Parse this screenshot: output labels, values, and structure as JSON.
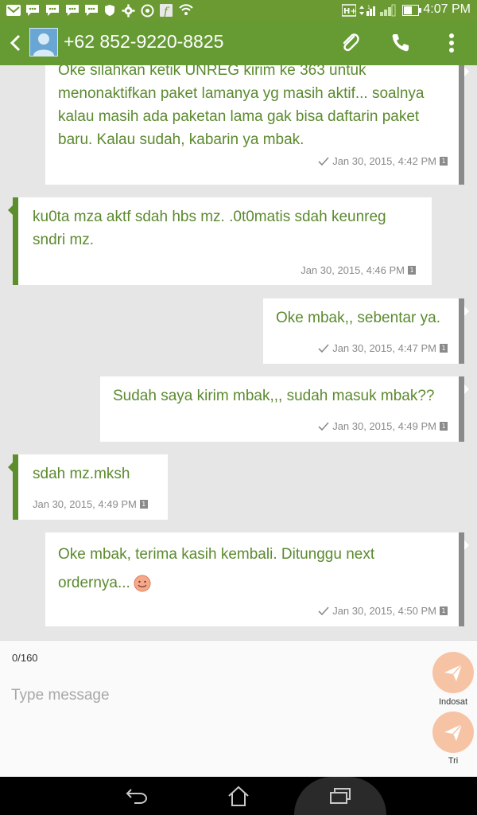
{
  "status_bar": {
    "time": "4:07 PM",
    "left_icons": [
      "gmail-icon",
      "bbm-icon",
      "bbm-icon",
      "bbm-icon",
      "bbm-icon",
      "shield-icon",
      "gear-icon",
      "soccer-icon",
      "facebook-icon",
      "wifi-icon"
    ],
    "right_icons": [
      "hplus-signal-icon",
      "signal-bars-icon",
      "sim-signal-icon",
      "battery-icon"
    ]
  },
  "header": {
    "contact": "+62 852-9220-8825",
    "actions": [
      "paperclip-icon",
      "phone-icon",
      "overflow-menu-icon"
    ]
  },
  "messages": [
    {
      "direction": "out",
      "text": "Oke silahkan ketik UNREG kirim ke 363 untuk menonaktifkan paket lamanya yg masih aktif... soalnya kalau masih ada paketan lama gak bisa daftarin paket baru. Kalau sudah, kabarin ya mbak.",
      "time": "Jan 30, 2015, 4:42 PM",
      "sim": "1"
    },
    {
      "direction": "in",
      "text": "ku0ta mza aktf sdah hbs mz. .0t0matis sdah keunreg sndri mz.",
      "time": "Jan 30, 2015, 4:46 PM",
      "sim": "1"
    },
    {
      "direction": "out",
      "text": "Oke mbak,, sebentar ya.",
      "time": "Jan 30, 2015, 4:47 PM",
      "sim": "1"
    },
    {
      "direction": "out",
      "text": "Sudah saya kirim mbak,,, sudah masuk mbak??",
      "time": "Jan 30, 2015, 4:49 PM",
      "sim": "1"
    },
    {
      "direction": "in",
      "text": "sdah mz.mksh",
      "time": "Jan 30, 2015, 4:49 PM",
      "sim": "1"
    },
    {
      "direction": "out",
      "text": "Oke mbak, terima kasih kembali. Ditunggu next ordernya...",
      "time": "Jan 30, 2015, 4:50 PM",
      "sim": "1"
    }
  ],
  "compose": {
    "char_count": "0/160",
    "placeholder": "Type message",
    "send_buttons": [
      {
        "label": "Indosat"
      },
      {
        "label": "Tri"
      }
    ]
  },
  "navigation": [
    "back-icon",
    "home-icon",
    "recents-icon"
  ],
  "colors": {
    "app_bar": "#669b34",
    "message_text": "#5b8a2f",
    "send_button": "#f7c3a5"
  }
}
